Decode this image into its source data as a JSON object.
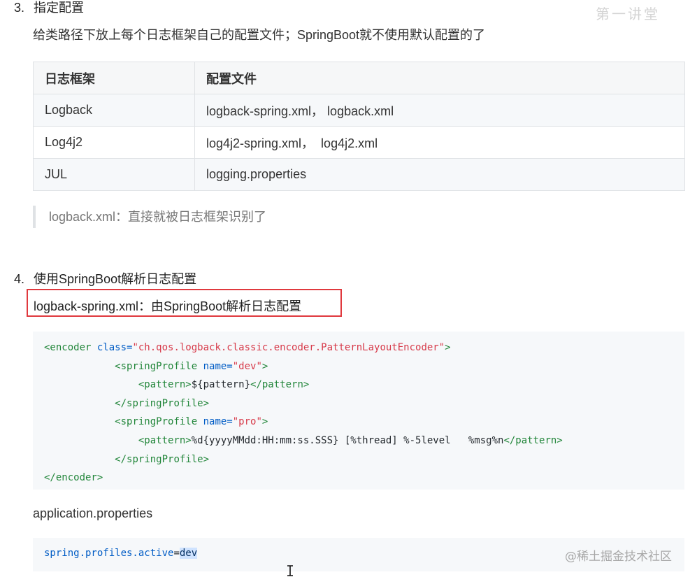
{
  "section3": {
    "number": "3.",
    "title": "指定配置",
    "intro": "给类路径下放上每个日志框架自己的配置文件；SpringBoot就不使用默认配置的了",
    "table": {
      "headers": [
        "日志框架",
        "配置文件"
      ],
      "rows": [
        [
          "Logback",
          "logback-spring.xml， logback.xml"
        ],
        [
          "Log4j2",
          "log4j2-spring.xml，  log4j2.xml"
        ],
        [
          "JUL",
          "logging.properties"
        ]
      ]
    },
    "note": "logback.xml：直接就被日志框架识别了"
  },
  "section4": {
    "number": "4.",
    "title": "使用SpringBoot解析日志配置",
    "highlight": "logback-spring.xml：由SpringBoot解析日志配置",
    "code": {
      "line1": {
        "open": "<encoder ",
        "attr": "class=",
        "value": "\"ch.qos.logback.classic.encoder.PatternLayoutEncoder\"",
        "close": ">"
      },
      "line2": {
        "indent": "            ",
        "open": "<springProfile ",
        "attr": "name=",
        "value": "\"dev\"",
        "close": ">"
      },
      "line3": {
        "indent": "                ",
        "open": "<pattern>",
        "text": "${pattern}",
        "close": "</pattern>"
      },
      "line4": {
        "indent": "            ",
        "tag": "</springProfile>"
      },
      "line5": {
        "indent": "            ",
        "open": "<springProfile ",
        "attr": "name=",
        "value": "\"pro\"",
        "close": ">"
      },
      "line6": {
        "indent": "                ",
        "open": "<pattern>",
        "text": "%d{yyyyMMdd:HH:mm:ss.SSS} [%thread] %-5level   %msg%n",
        "close": "</pattern>"
      },
      "line7": {
        "indent": "            ",
        "tag": "</springProfile>"
      },
      "line8": {
        "tag": "</encoder>"
      }
    },
    "props_label": "application.properties",
    "props_code": {
      "key": "spring.profiles.active",
      "eq": "=",
      "value": "dev"
    }
  },
  "watermark": "@稀土掘金技术社区",
  "corner_mark": "第一讲堂"
}
